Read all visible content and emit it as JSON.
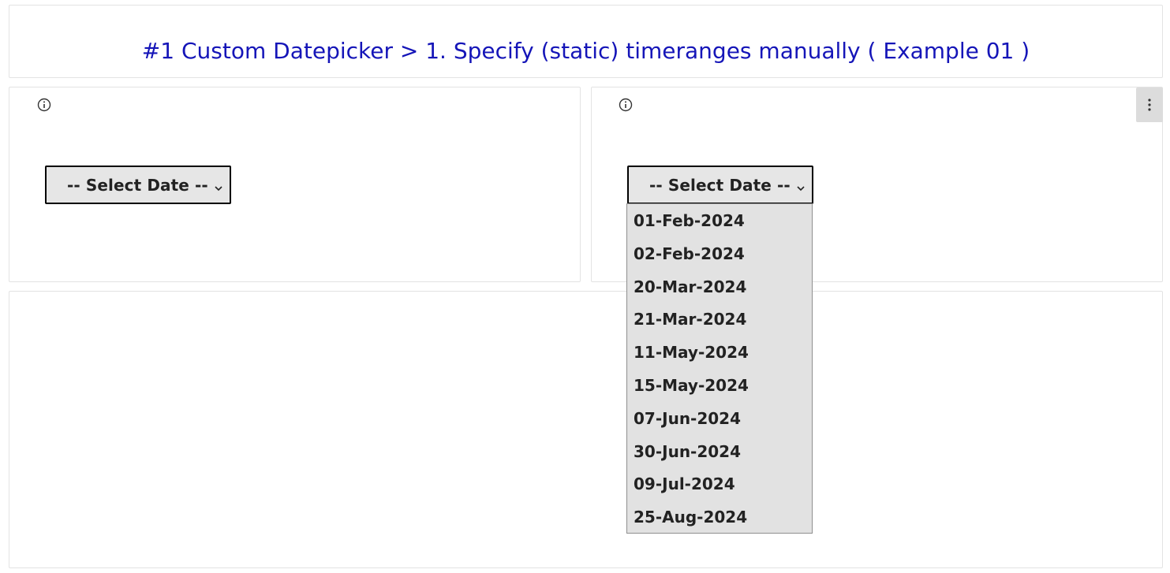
{
  "header": {
    "title": "#1 Custom Datepicker > 1. Specify (static) timeranges manually ( Example 01 )"
  },
  "left_panel": {
    "info_icon": "info-circle-icon",
    "select": {
      "selected_label": "-- Select Date --",
      "chevron_icon": "chevron-down-icon"
    }
  },
  "right_panel": {
    "info_icon": "info-circle-icon",
    "menu_icon": "kebab-vertical-icon",
    "select": {
      "selected_label": "-- Select Date --",
      "chevron_icon": "chevron-down-icon",
      "options": [
        "01-Feb-2024",
        "02-Feb-2024",
        "20-Mar-2024",
        "21-Mar-2024",
        "11-May-2024",
        "15-May-2024",
        "07-Jun-2024",
        "30-Jun-2024",
        "09-Jul-2024",
        "25-Aug-2024"
      ]
    }
  },
  "colors": {
    "title": "#1515b8",
    "panel_border": "#e3e3e3",
    "select_bg": "#e6e6e6",
    "dropdown_bg": "#e2e2e2"
  }
}
